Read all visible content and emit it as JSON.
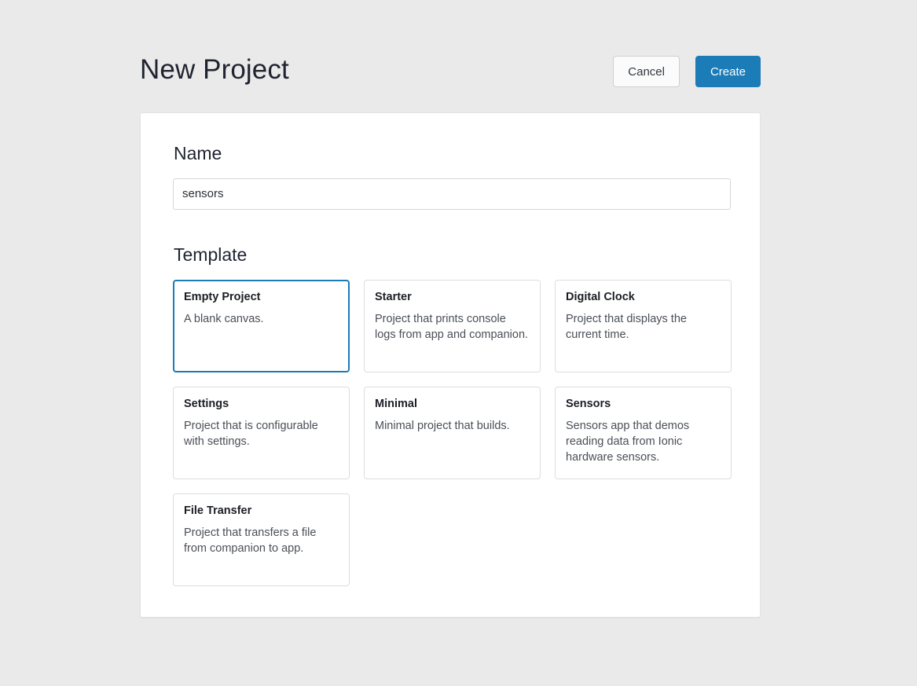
{
  "header": {
    "title": "New Project",
    "cancel_label": "Cancel",
    "create_label": "Create"
  },
  "form": {
    "name_label": "Name",
    "name_value": "sensors",
    "name_placeholder": "",
    "template_label": "Template"
  },
  "templates": [
    {
      "title": "Empty Project",
      "description": "A blank canvas.",
      "selected": true
    },
    {
      "title": "Starter",
      "description": "Project that prints console logs from app and companion.",
      "selected": false
    },
    {
      "title": "Digital Clock",
      "description": "Project that displays the current time.",
      "selected": false
    },
    {
      "title": "Settings",
      "description": "Project that is configurable with settings.",
      "selected": false
    },
    {
      "title": "Minimal",
      "description": "Minimal project that builds.",
      "selected": false
    },
    {
      "title": "Sensors",
      "description": "Sensors app that demos reading data from Ionic hardware sensors.",
      "selected": false
    },
    {
      "title": "File Transfer",
      "description": "Project that transfers a file from companion to app.",
      "selected": false
    }
  ],
  "colors": {
    "page_background": "#eaeaea",
    "panel_background": "#ffffff",
    "accent": "#1b7cb8",
    "border": "#dddddd",
    "text_primary": "#1f2430",
    "text_secondary": "#4a4f57"
  }
}
